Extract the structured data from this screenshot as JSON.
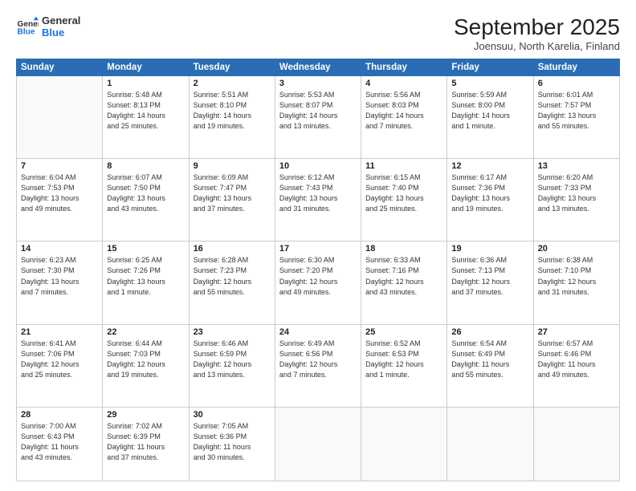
{
  "header": {
    "logo_line1": "General",
    "logo_line2": "Blue",
    "title": "September 2025",
    "subtitle": "Joensuu, North Karelia, Finland"
  },
  "columns": [
    "Sunday",
    "Monday",
    "Tuesday",
    "Wednesday",
    "Thursday",
    "Friday",
    "Saturday"
  ],
  "weeks": [
    [
      {
        "day": "",
        "info": ""
      },
      {
        "day": "1",
        "info": "Sunrise: 5:48 AM\nSunset: 8:13 PM\nDaylight: 14 hours\nand 25 minutes."
      },
      {
        "day": "2",
        "info": "Sunrise: 5:51 AM\nSunset: 8:10 PM\nDaylight: 14 hours\nand 19 minutes."
      },
      {
        "day": "3",
        "info": "Sunrise: 5:53 AM\nSunset: 8:07 PM\nDaylight: 14 hours\nand 13 minutes."
      },
      {
        "day": "4",
        "info": "Sunrise: 5:56 AM\nSunset: 8:03 PM\nDaylight: 14 hours\nand 7 minutes."
      },
      {
        "day": "5",
        "info": "Sunrise: 5:59 AM\nSunset: 8:00 PM\nDaylight: 14 hours\nand 1 minute."
      },
      {
        "day": "6",
        "info": "Sunrise: 6:01 AM\nSunset: 7:57 PM\nDaylight: 13 hours\nand 55 minutes."
      }
    ],
    [
      {
        "day": "7",
        "info": "Sunrise: 6:04 AM\nSunset: 7:53 PM\nDaylight: 13 hours\nand 49 minutes."
      },
      {
        "day": "8",
        "info": "Sunrise: 6:07 AM\nSunset: 7:50 PM\nDaylight: 13 hours\nand 43 minutes."
      },
      {
        "day": "9",
        "info": "Sunrise: 6:09 AM\nSunset: 7:47 PM\nDaylight: 13 hours\nand 37 minutes."
      },
      {
        "day": "10",
        "info": "Sunrise: 6:12 AM\nSunset: 7:43 PM\nDaylight: 13 hours\nand 31 minutes."
      },
      {
        "day": "11",
        "info": "Sunrise: 6:15 AM\nSunset: 7:40 PM\nDaylight: 13 hours\nand 25 minutes."
      },
      {
        "day": "12",
        "info": "Sunrise: 6:17 AM\nSunset: 7:36 PM\nDaylight: 13 hours\nand 19 minutes."
      },
      {
        "day": "13",
        "info": "Sunrise: 6:20 AM\nSunset: 7:33 PM\nDaylight: 13 hours\nand 13 minutes."
      }
    ],
    [
      {
        "day": "14",
        "info": "Sunrise: 6:23 AM\nSunset: 7:30 PM\nDaylight: 13 hours\nand 7 minutes."
      },
      {
        "day": "15",
        "info": "Sunrise: 6:25 AM\nSunset: 7:26 PM\nDaylight: 13 hours\nand 1 minute."
      },
      {
        "day": "16",
        "info": "Sunrise: 6:28 AM\nSunset: 7:23 PM\nDaylight: 12 hours\nand 55 minutes."
      },
      {
        "day": "17",
        "info": "Sunrise: 6:30 AM\nSunset: 7:20 PM\nDaylight: 12 hours\nand 49 minutes."
      },
      {
        "day": "18",
        "info": "Sunrise: 6:33 AM\nSunset: 7:16 PM\nDaylight: 12 hours\nand 43 minutes."
      },
      {
        "day": "19",
        "info": "Sunrise: 6:36 AM\nSunset: 7:13 PM\nDaylight: 12 hours\nand 37 minutes."
      },
      {
        "day": "20",
        "info": "Sunrise: 6:38 AM\nSunset: 7:10 PM\nDaylight: 12 hours\nand 31 minutes."
      }
    ],
    [
      {
        "day": "21",
        "info": "Sunrise: 6:41 AM\nSunset: 7:06 PM\nDaylight: 12 hours\nand 25 minutes."
      },
      {
        "day": "22",
        "info": "Sunrise: 6:44 AM\nSunset: 7:03 PM\nDaylight: 12 hours\nand 19 minutes."
      },
      {
        "day": "23",
        "info": "Sunrise: 6:46 AM\nSunset: 6:59 PM\nDaylight: 12 hours\nand 13 minutes."
      },
      {
        "day": "24",
        "info": "Sunrise: 6:49 AM\nSunset: 6:56 PM\nDaylight: 12 hours\nand 7 minutes."
      },
      {
        "day": "25",
        "info": "Sunrise: 6:52 AM\nSunset: 6:53 PM\nDaylight: 12 hours\nand 1 minute."
      },
      {
        "day": "26",
        "info": "Sunrise: 6:54 AM\nSunset: 6:49 PM\nDaylight: 11 hours\nand 55 minutes."
      },
      {
        "day": "27",
        "info": "Sunrise: 6:57 AM\nSunset: 6:46 PM\nDaylight: 11 hours\nand 49 minutes."
      }
    ],
    [
      {
        "day": "28",
        "info": "Sunrise: 7:00 AM\nSunset: 6:43 PM\nDaylight: 11 hours\nand 43 minutes."
      },
      {
        "day": "29",
        "info": "Sunrise: 7:02 AM\nSunset: 6:39 PM\nDaylight: 11 hours\nand 37 minutes."
      },
      {
        "day": "30",
        "info": "Sunrise: 7:05 AM\nSunset: 6:36 PM\nDaylight: 11 hours\nand 30 minutes."
      },
      {
        "day": "",
        "info": ""
      },
      {
        "day": "",
        "info": ""
      },
      {
        "day": "",
        "info": ""
      },
      {
        "day": "",
        "info": ""
      }
    ]
  ]
}
